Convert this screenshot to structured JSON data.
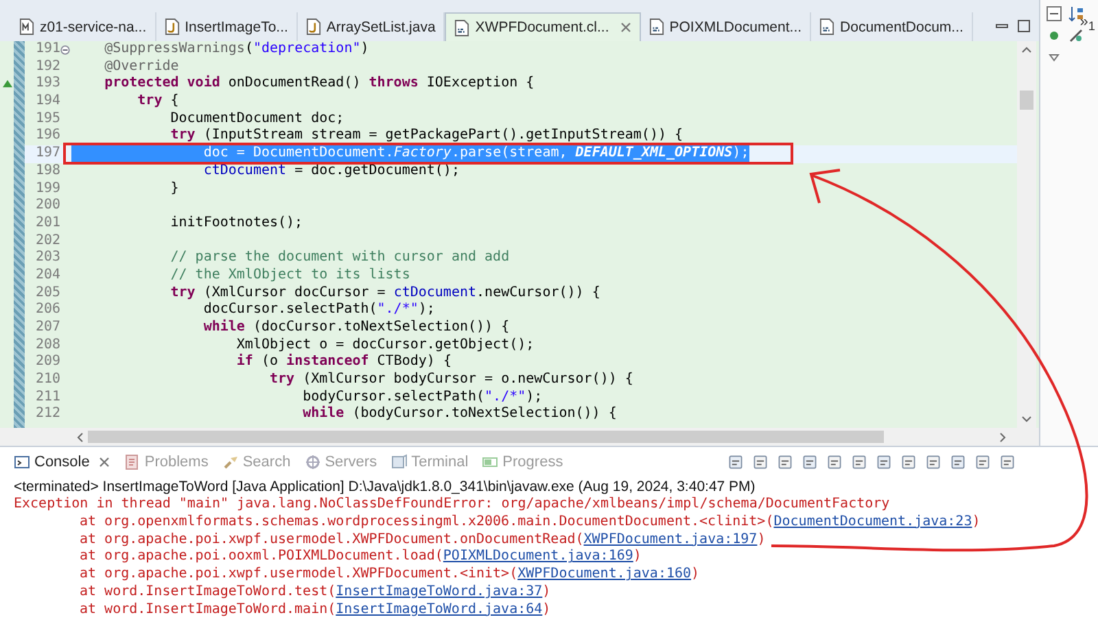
{
  "editor_tabs": [
    {
      "label": "z01-service-na...",
      "kind": "maven",
      "selected": false
    },
    {
      "label": "InsertImageTo...",
      "kind": "java",
      "selected": false
    },
    {
      "label": "ArraySetList.java",
      "kind": "java",
      "selected": false
    },
    {
      "label": "XWPFDocument.cl...",
      "kind": "class",
      "selected": true
    },
    {
      "label": "POIXMLDocument...",
      "kind": "class",
      "selected": false
    },
    {
      "label": "DocumentDocum...",
      "kind": "class",
      "selected": false
    }
  ],
  "tab_overflow": "»$_{1}$",
  "code_lines": [
    {
      "number": "191",
      "expanded": true,
      "selected": false,
      "tokens": [
        {
          "kind": "annotation",
          "text": "    @SuppressWarnings"
        },
        {
          "kind": "plain",
          "text": "("
        },
        {
          "kind": "string",
          "text": "\"deprecation\""
        },
        {
          "kind": "plain",
          "text": ")"
        }
      ]
    },
    {
      "number": "192",
      "selected": false,
      "tokens": [
        {
          "kind": "annotation",
          "text": "    @Override"
        }
      ]
    },
    {
      "number": "193",
      "overrides": true,
      "selected": false,
      "tokens": [
        {
          "kind": "keyword",
          "text": "    protected void"
        },
        {
          "kind": "plain",
          "text": " onDocumentRead() "
        },
        {
          "kind": "keyword",
          "text": "throws"
        },
        {
          "kind": "plain",
          "text": " IOException {"
        }
      ]
    },
    {
      "number": "194",
      "selected": false,
      "tokens": [
        {
          "kind": "keyword",
          "text": "        try"
        },
        {
          "kind": "plain",
          "text": " {"
        }
      ]
    },
    {
      "number": "195",
      "selected": false,
      "tokens": [
        {
          "kind": "plain",
          "text": "            DocumentDocument doc;"
        }
      ]
    },
    {
      "number": "196",
      "selected": false,
      "tokens": [
        {
          "kind": "keyword",
          "text": "            try"
        },
        {
          "kind": "plain",
          "text": " (InputStream stream = getPackagePart().getInputStream()) {"
        }
      ]
    },
    {
      "number": "197",
      "selected": true,
      "tokens": [
        {
          "kind": "plain",
          "text": "                doc = DocumentDocument."
        },
        {
          "kind": "static",
          "text": "Factory"
        },
        {
          "kind": "plain",
          "text": ".parse(stream, "
        },
        {
          "kind": "constant",
          "text": "DEFAULT_XML_OPTIONS"
        },
        {
          "kind": "plain",
          "text": ");"
        }
      ]
    },
    {
      "number": "198",
      "selected": false,
      "tokens": [
        {
          "kind": "field",
          "text": "                ctDocument"
        },
        {
          "kind": "plain",
          "text": " = doc.getDocument();"
        }
      ]
    },
    {
      "number": "199",
      "selected": false,
      "tokens": [
        {
          "kind": "plain",
          "text": "            }"
        }
      ]
    },
    {
      "number": "200",
      "selected": false
    },
    {
      "number": "201",
      "selected": false,
      "tokens": [
        {
          "kind": "plain",
          "text": "            initFootnotes();"
        }
      ]
    },
    {
      "number": "202",
      "selected": false
    },
    {
      "number": "203",
      "selected": false,
      "tokens": [
        {
          "kind": "comment",
          "text": "            // parse the document with cursor and add"
        }
      ]
    },
    {
      "number": "204",
      "selected": false,
      "tokens": [
        {
          "kind": "comment",
          "text": "            // the XmlObject to its lists"
        }
      ]
    },
    {
      "number": "205",
      "selected": false,
      "tokens": [
        {
          "kind": "keyword",
          "text": "            try"
        },
        {
          "kind": "plain",
          "text": " (XmlCursor docCursor = "
        },
        {
          "kind": "field",
          "text": "ctDocument"
        },
        {
          "kind": "plain",
          "text": ".newCursor()) {"
        }
      ]
    },
    {
      "number": "206",
      "selected": false,
      "tokens": [
        {
          "kind": "plain",
          "text": "                docCursor.selectPath("
        },
        {
          "kind": "string",
          "text": "\"./*\""
        },
        {
          "kind": "plain",
          "text": ");"
        }
      ]
    },
    {
      "number": "207",
      "selected": false,
      "tokens": [
        {
          "kind": "keyword",
          "text": "                while"
        },
        {
          "kind": "plain",
          "text": " (docCursor.toNextSelection()) {"
        }
      ]
    },
    {
      "number": "208",
      "selected": false,
      "tokens": [
        {
          "kind": "plain",
          "text": "                    XmlObject o = docCursor.getObject();"
        }
      ]
    },
    {
      "number": "209",
      "selected": false,
      "tokens": [
        {
          "kind": "keyword",
          "text": "                    if"
        },
        {
          "kind": "plain",
          "text": " (o "
        },
        {
          "kind": "keyword",
          "text": "instanceof"
        },
        {
          "kind": "plain",
          "text": " CTBody) {"
        }
      ]
    },
    {
      "number": "210",
      "selected": false,
      "tokens": [
        {
          "kind": "keyword",
          "text": "                        try"
        },
        {
          "kind": "plain",
          "text": " (XmlCursor bodyCursor = o.newCursor()) {"
        }
      ]
    },
    {
      "number": "211",
      "selected": false,
      "tokens": [
        {
          "kind": "plain",
          "text": "                            bodyCursor.selectPath("
        },
        {
          "kind": "string",
          "text": "\"./*\""
        },
        {
          "kind": "plain",
          "text": ");"
        }
      ]
    },
    {
      "number": "212",
      "selected": false,
      "tokens": [
        {
          "kind": "keyword",
          "text": "                            while"
        },
        {
          "kind": "plain",
          "text": " (bodyCursor.toNextSelection()) {"
        }
      ]
    }
  ],
  "console_tabs": [
    {
      "label": "Console",
      "kind": "console",
      "selected": true
    },
    {
      "label": "Problems",
      "kind": "problems",
      "selected": false
    },
    {
      "label": "Search",
      "kind": "search",
      "selected": false
    },
    {
      "label": "Servers",
      "kind": "servers",
      "selected": false
    },
    {
      "label": "Terminal",
      "kind": "terminal",
      "selected": false
    },
    {
      "label": "Progress",
      "kind": "progress",
      "selected": false
    }
  ],
  "console_status": "<terminated> InsertImageToWord [Java Application] D:\\Java\\jdk1.8.0_341\\bin\\javaw.exe (Aug 19, 2024, 3:40:47 PM)",
  "console_output": [
    {
      "kind": "error",
      "text": "Exception in thread \"main\" java.lang.NoClassDefFoundError: org/apache/xmlbeans/impl/schema/DocumentFactory"
    },
    {
      "kind": "frame",
      "text": "at org.openxmlformats.schemas.wordprocessingml.x2006.main.DocumentDocument.<clinit>(",
      "link": "DocumentDocument.java:23",
      "suffix": ")"
    },
    {
      "kind": "frame",
      "text": "at org.apache.poi.xwpf.usermodel.XWPFDocument.onDocumentRead(",
      "link": "XWPFDocument.java:197",
      "suffix": ")"
    },
    {
      "kind": "frame",
      "text": "at org.apache.poi.ooxml.POIXMLDocument.load(",
      "link": "POIXMLDocument.java:169",
      "suffix": ")"
    },
    {
      "kind": "frame",
      "text": "at org.apache.poi.xwpf.usermodel.XWPFDocument.<init>(",
      "link": "XWPFDocument.java:160",
      "suffix": ")"
    },
    {
      "kind": "frame",
      "text": "at word.InsertImageToWord.test(",
      "link": "InsertImageToWord.java:37",
      "suffix": ")"
    },
    {
      "kind": "frame",
      "text": "at word.InsertImageToWord.main(",
      "link": "InsertImageToWord.java:64",
      "suffix": ")"
    }
  ]
}
